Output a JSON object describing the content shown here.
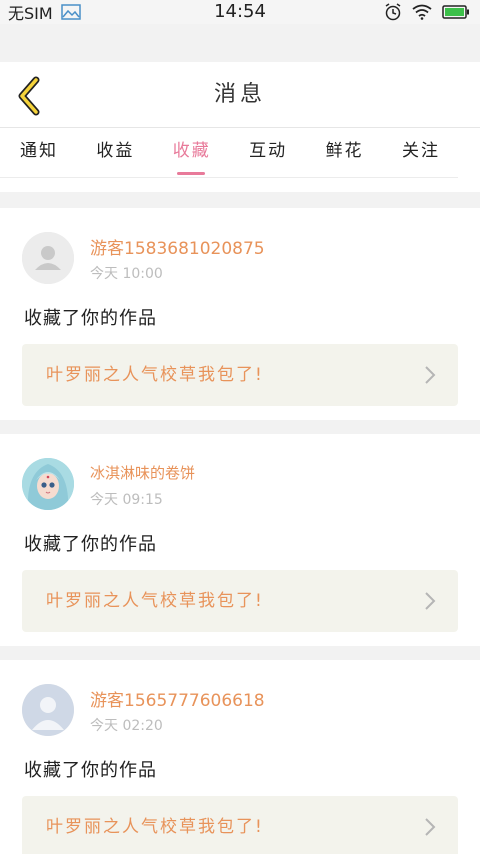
{
  "status_bar": {
    "carrier": "无SIM",
    "time": "14:54",
    "icons": [
      "image-icon",
      "alarm-icon",
      "wifi-icon",
      "battery-icon"
    ]
  },
  "header": {
    "title": "消息",
    "back_icon": "chevron-left-icon"
  },
  "tabs": [
    {
      "label": "通知",
      "active": false
    },
    {
      "label": "收益",
      "active": false
    },
    {
      "label": "收藏",
      "active": true
    },
    {
      "label": "互动",
      "active": false
    },
    {
      "label": "鲜花",
      "active": false
    },
    {
      "label": "关注",
      "active": false
    }
  ],
  "accent_colors": {
    "active_tab": "#e87a9a",
    "username": "#e8935a",
    "work_bg": "#f3f3ec"
  },
  "messages": [
    {
      "username": "游客1583681020875",
      "time": "今天 10:00",
      "action": "收藏了你的作品",
      "work_title": "叶罗丽之人气校草我包了!",
      "avatar": "default-avatar"
    },
    {
      "username": "冰淇淋味的卷饼",
      "time": "今天 09:15",
      "action": "收藏了你的作品",
      "work_title": "叶罗丽之人气校草我包了!",
      "avatar": "character-avatar"
    },
    {
      "username": "游客1565777606618",
      "time": "今天 02:20",
      "action": "收藏了你的作品",
      "work_title": "叶罗丽之人气校草我包了!",
      "avatar": "default-avatar-blue"
    }
  ]
}
